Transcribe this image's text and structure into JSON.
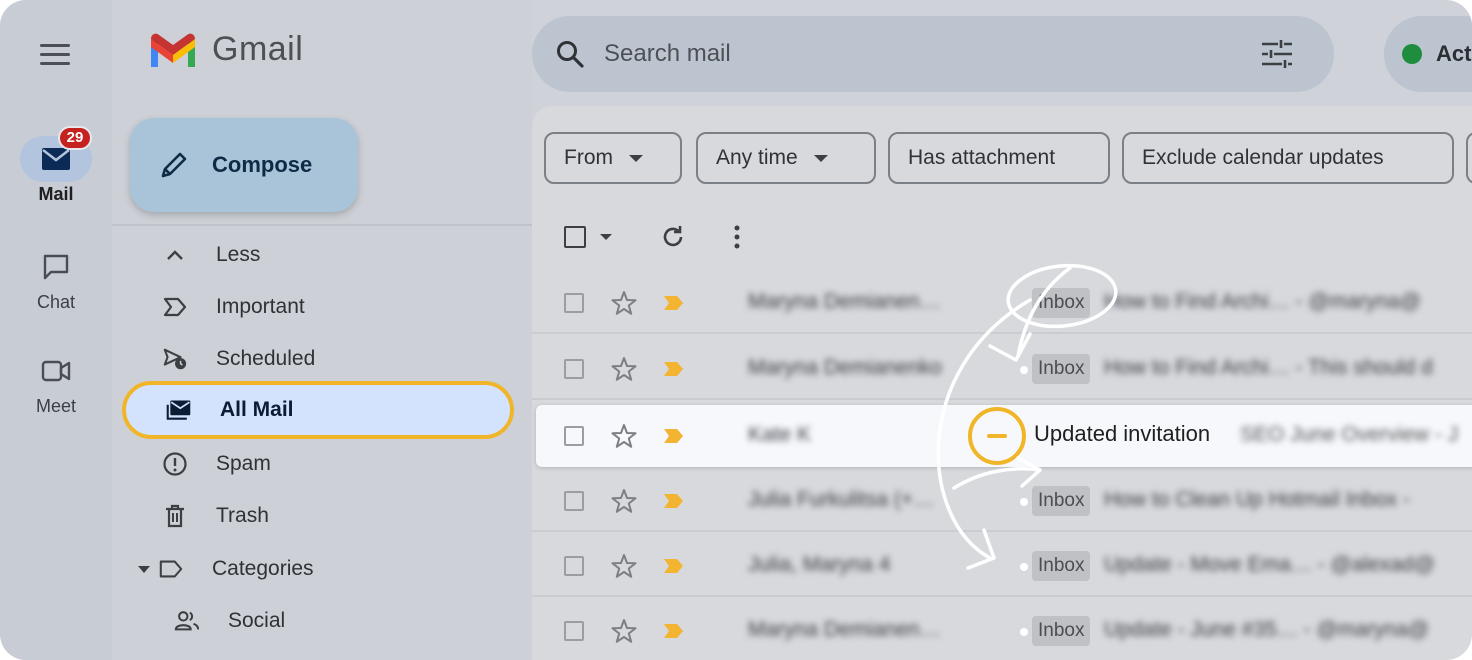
{
  "app": {
    "name": "Gmail"
  },
  "rail": {
    "items": [
      {
        "label": "Mail",
        "icon": "mail-icon",
        "badge": "29",
        "active": true
      },
      {
        "label": "Chat",
        "icon": "chat-icon"
      },
      {
        "label": "Meet",
        "icon": "video-icon"
      }
    ]
  },
  "sidebar": {
    "compose_label": "Compose",
    "items": [
      {
        "label": "Less",
        "icon": "chevron-up-icon"
      },
      {
        "label": "Important",
        "icon": "important-icon"
      },
      {
        "label": "Scheduled",
        "icon": "scheduled-icon"
      },
      {
        "label": "All Mail",
        "icon": "all-mail-icon",
        "selected": true
      },
      {
        "label": "Spam",
        "icon": "spam-icon"
      },
      {
        "label": "Trash",
        "icon": "trash-icon"
      },
      {
        "label": "Categories",
        "icon": "label-icon"
      },
      {
        "label": "Social",
        "icon": "social-icon"
      }
    ]
  },
  "search": {
    "placeholder": "Search mail"
  },
  "status": {
    "label": "Act",
    "color": "#1e8e3e"
  },
  "filters": [
    {
      "label": "From",
      "dropdown": true
    },
    {
      "label": "Any time",
      "dropdown": true
    },
    {
      "label": "Has attachment"
    },
    {
      "label": "Exclude calendar updates"
    }
  ],
  "emails": [
    {
      "sender": "Maryna Demianen…",
      "label": "Inbox",
      "subject": "How to Find Archi… - @maryna@"
    },
    {
      "sender": "Maryna Demianenko",
      "label": "Inbox",
      "subject": "How to Find Archi… - This should d"
    },
    {
      "sender": "Kate K",
      "label": "",
      "subject_main": "Updated invitation",
      "subject_rest": "SEO June Overview - J",
      "highlight": true
    },
    {
      "sender": "Julia Furkulitsa (+…",
      "label": "Inbox",
      "subject": "How to Clean Up Hotmail Inbox -"
    },
    {
      "sender": "Julia, Maryna 4",
      "label": "Inbox",
      "subject": "Update - Move Ema… - @alexad@"
    },
    {
      "sender": "Maryna Demianen…",
      "label": "Inbox",
      "subject": "Update - June #35… - @maryna@"
    }
  ],
  "colors": {
    "accent": "#f1b529",
    "badge": "#c5221f",
    "selected_bg": "#d3e3fd",
    "important": "#f2b431"
  }
}
